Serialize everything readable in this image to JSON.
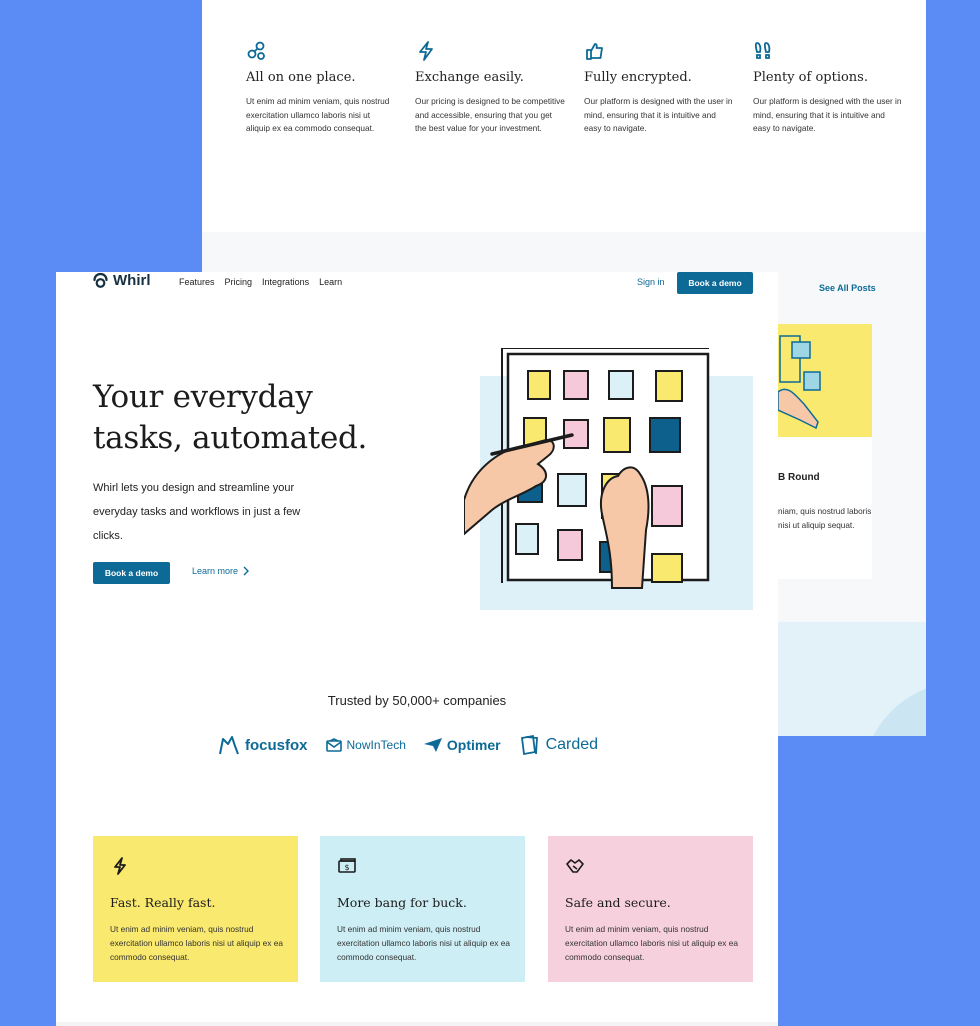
{
  "colors": {
    "page_bg": "#5b8cf5",
    "accent": "#0d6a96",
    "yellow": "#f9e96f",
    "cyan": "#cdeef4",
    "pink": "#f6d0dd"
  },
  "back_page": {
    "features": [
      {
        "icon": "nodes-icon",
        "title": "All on one place.",
        "desc": "Ut enim ad minim veniam, quis nostrud exercitation ullamco laboris nisi ut aliquip ex ea commodo consequat."
      },
      {
        "icon": "lightning-icon",
        "title": "Exchange easily.",
        "desc": "Our pricing is designed to be competitive and accessible, ensuring that you get the best value for your investment."
      },
      {
        "icon": "thumbs-up-icon",
        "title": "Fully encrypted.",
        "desc": "Our platform is designed with the user in mind, ensuring that it is intuitive and easy to navigate."
      },
      {
        "icon": "footprints-icon",
        "title": "Plenty of options.",
        "desc": "Our platform is designed with the user in mind, ensuring that it is intuitive and easy to navigate."
      }
    ],
    "see_all": "See All Posts",
    "post": {
      "title": "B Round",
      "desc": "niam, quis nostrud laboris nisi ut aliquip sequat."
    }
  },
  "header": {
    "brand": "Whirl",
    "nav": [
      "Features",
      "Pricing",
      "Integrations",
      "Learn"
    ],
    "sign_in": "Sign in",
    "book_demo": "Book a demo"
  },
  "hero": {
    "title_line1": "Your everyday",
    "title_line2": "tasks, automated.",
    "desc": "Whirl lets you design and streamline your everyday tasks and workflows in just a few clicks.",
    "cta_primary": "Book a demo",
    "cta_secondary": "Learn more"
  },
  "trusted": {
    "text": "Trusted by 50,000+ companies",
    "logos": [
      "focusfox",
      "NowInTech",
      "Optimer",
      "Carded"
    ]
  },
  "cards": [
    {
      "icon": "lightning-icon",
      "title": "Fast. Really fast.",
      "desc": "Ut enim ad minim veniam, quis nostrud exercitation ullamco laboris nisi ut aliquip ex ea commodo consequat."
    },
    {
      "icon": "money-icon",
      "title": "More bang for buck.",
      "desc": "Ut enim ad minim veniam, quis nostrud exercitation ullamco laboris nisi ut aliquip ex ea commodo consequat."
    },
    {
      "icon": "handshake-icon",
      "title": "Safe and secure.",
      "desc": "Ut enim ad minim veniam, quis nostrud exercitation ullamco laboris nisi ut aliquip ex ea commodo consequat."
    }
  ]
}
